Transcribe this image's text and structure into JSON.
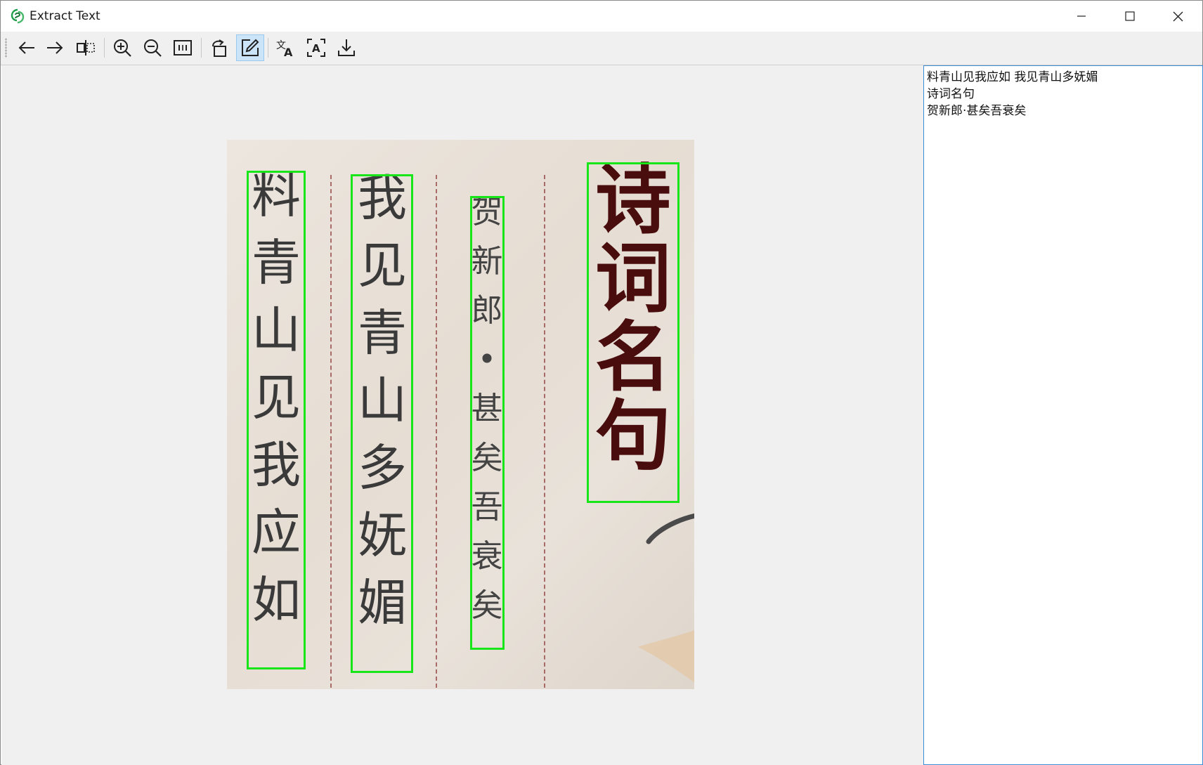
{
  "window": {
    "title": "Extract Text",
    "icon": "app-logo-icon",
    "controls": [
      "minimize-icon",
      "maximize-icon",
      "close-icon"
    ]
  },
  "toolbar": {
    "buttons": [
      {
        "name": "back",
        "icon": "arrow-left-icon"
      },
      {
        "name": "forward",
        "icon": "arrow-right-icon"
      },
      {
        "name": "compare",
        "icon": "split-view-icon"
      },
      {
        "name": "zoom-in",
        "icon": "zoom-in-icon"
      },
      {
        "name": "zoom-out",
        "icon": "zoom-out-icon"
      },
      {
        "name": "fit",
        "icon": "fit-to-window-icon"
      },
      {
        "name": "rotate",
        "icon": "rotate-icon"
      },
      {
        "name": "edit",
        "icon": "edit-icon",
        "active": true
      },
      {
        "name": "translate",
        "icon": "translate-icon"
      },
      {
        "name": "recognize",
        "icon": "ocr-icon"
      },
      {
        "name": "download",
        "icon": "download-icon"
      }
    ]
  },
  "image": {
    "columns": [
      {
        "chars": [
          "料",
          "青",
          "山",
          "见",
          "我",
          "应",
          "如"
        ]
      },
      {
        "chars": [
          "我",
          "见",
          "青",
          "山",
          "多",
          "妩",
          "媚"
        ]
      },
      {
        "chars": [
          "贺",
          "新",
          "郎",
          "•",
          "甚",
          "矣",
          "吾",
          "衰",
          "矣"
        ]
      },
      {
        "chars": [
          "诗",
          "词",
          "名",
          "句"
        ]
      }
    ],
    "box_color": "#19e619"
  },
  "result": {
    "lines": [
      "料青山见我应如 我见青山多妩媚",
      "诗词名句",
      "贺新郎·甚矣吾衰矣"
    ]
  }
}
